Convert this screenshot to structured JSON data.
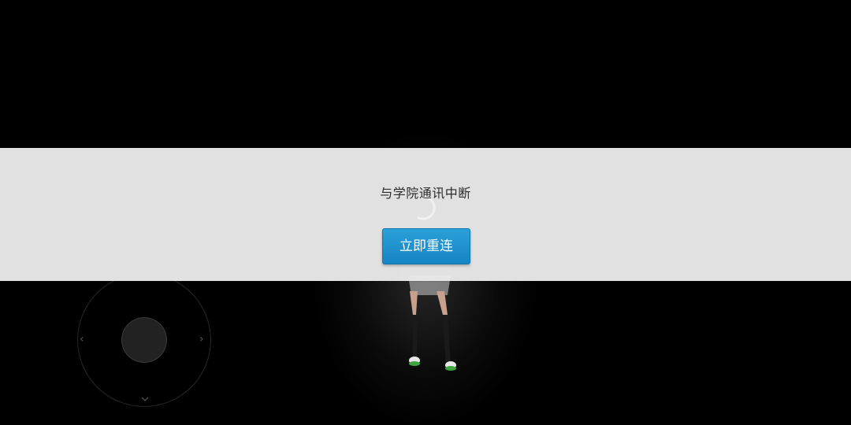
{
  "dialog": {
    "message": "与学院通讯中断",
    "reconnect_label": "立即重连"
  },
  "colors": {
    "background": "#000000",
    "dialog_band": "#e8e8e8",
    "button": "#1b8fcc",
    "button_text": "#ffffff",
    "message_text": "#2b2b2b"
  },
  "icons": {
    "joystick_left": "chevron-left-icon",
    "joystick_right": "chevron-right-icon",
    "joystick_down": "chevron-down-icon",
    "loading": "spinner-icon"
  }
}
